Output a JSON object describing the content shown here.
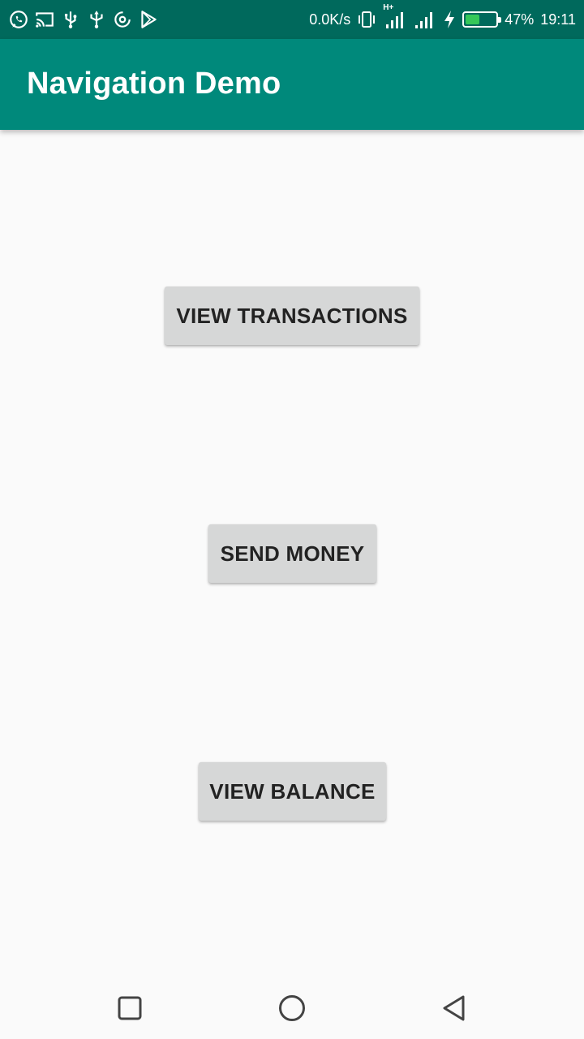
{
  "status_bar": {
    "net_speed": "0.0K/s",
    "network_type": "H+",
    "battery_percent": "47%",
    "battery_level": 0.47,
    "time": "19:11",
    "left_icons": [
      "whatsapp-icon",
      "cast-icon",
      "usb-icon",
      "usb-icon",
      "sync-icon",
      "play-store-icon"
    ]
  },
  "app_bar": {
    "title": "Navigation Demo",
    "color": "#00897b"
  },
  "buttons": {
    "view_transactions": "VIEW TRANSACTIONS",
    "send_money": "SEND MONEY",
    "view_balance": "VIEW BALANCE"
  },
  "nav_bar": {
    "icons": [
      "recent-apps-icon",
      "home-icon",
      "back-icon"
    ]
  }
}
